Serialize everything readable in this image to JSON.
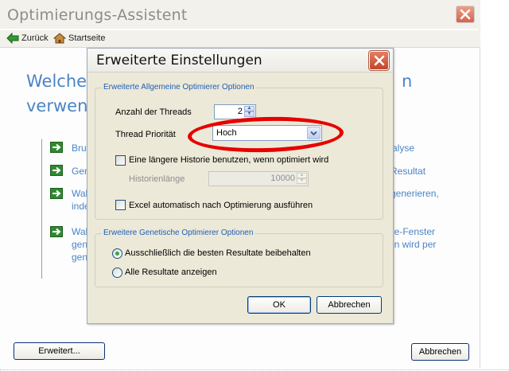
{
  "window": {
    "title": "Optimierungs-Assistent",
    "close_glyph": "✕"
  },
  "nav": {
    "back_label": "Zurück",
    "home_label": "Startseite"
  },
  "wizard": {
    "heading_left_line1": "Welche",
    "heading_left_line2": "verwend",
    "heading_right_fragment": "n",
    "links": [
      {
        "left": "Brut",
        "right": "alyse"
      },
      {
        "left": "Gen",
        "right": "Resultat"
      },
      {
        "left_line1": "Wall",
        "left_line2": "inde",
        "right": "generieren,"
      },
      {
        "left_line1": "Wall",
        "left_line2": "gene",
        "left_line3": "gene",
        "right_line1": "de-Fenster",
        "right_line2": "en wird per"
      }
    ],
    "advanced_button": "Erweitert...",
    "cancel_button": "Abbrechen"
  },
  "dialog": {
    "title": "Erweiterte Einstellungen",
    "group_general": {
      "legend": "Erweiterte Allgemeine Optimierer Optionen",
      "threads_label": "Anzahl der Threads",
      "threads_value": "2",
      "priority_label": "Thread Priorität",
      "priority_value": "Hoch",
      "history_checkbox_label": "Eine längere Historie benutzen, wenn optimiert wird",
      "history_checked": false,
      "history_length_label": "Historienlänge",
      "history_length_value": "10000",
      "excel_checkbox_label": "Excel automatisch nach Optimierung ausführen",
      "excel_checked": false
    },
    "group_genetic": {
      "legend": "Erweitere Genetische Optimierer Optionen",
      "option_best_label": "Ausschließlich die besten Resultate beibehalten",
      "option_best_selected": true,
      "option_all_label": "Alle Resultate anzeigen",
      "option_all_selected": false
    },
    "ok_button": "OK",
    "cancel_button": "Abbrechen"
  },
  "colors": {
    "accent_blue": "#4a84c6",
    "legend_blue": "#1f5fb6",
    "annotation_red": "#e60000",
    "dialog_bg": "#ece9d8"
  },
  "icons": [
    "back-arrow-icon",
    "home-icon",
    "close-icon",
    "green-arrow-icon",
    "spin-up-icon",
    "spin-down-icon",
    "dropdown-chevron-icon"
  ]
}
